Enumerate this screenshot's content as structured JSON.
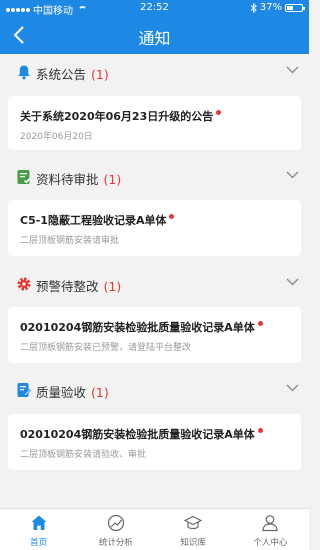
{
  "status_bar": {
    "carrier": "中国移动",
    "time": "22:52",
    "battery_text": "37%",
    "battery_level": 0.37
  },
  "header": {
    "title": "通知"
  },
  "sections": [
    {
      "title": "系统公告",
      "count": "(1)",
      "icon": "bell-icon",
      "item": {
        "title": "关于系统2020年06月23日升级的公告",
        "subtitle": "2020年06月20日"
      }
    },
    {
      "title": "资料待审批",
      "count": "(1)",
      "icon": "document-approve-icon",
      "item": {
        "title": "C5-1隐蔽工程验收记录A单体",
        "subtitle": "二层顶板钢筋安装请审批"
      }
    },
    {
      "title": "预警待整改",
      "count": "(1)",
      "icon": "warning-gear-icon",
      "item": {
        "title": "02010204钢筋安装检验批质量验收记录A单体",
        "subtitle": "二层顶板钢筋安装已预警，请登陆平台整改"
      }
    },
    {
      "title": "质量验收",
      "count": "(1)",
      "icon": "quality-check-icon",
      "item": {
        "title": "02010204钢筋安装检验批质量验收记录A单体",
        "subtitle": "二层顶板钢筋安装请验收、审批"
      }
    }
  ],
  "tabs": [
    {
      "label": "首页",
      "icon": "home-icon",
      "active": true
    },
    {
      "label": "统计分析",
      "icon": "chart-icon",
      "active": false
    },
    {
      "label": "知识库",
      "icon": "graduation-cap-icon",
      "active": false
    },
    {
      "label": "个人中心",
      "icon": "person-icon",
      "active": false
    }
  ],
  "colors": {
    "primary": "#1e88e5",
    "badge": "#e53935",
    "approve_green": "#43a047",
    "warning_red": "#e53935"
  }
}
